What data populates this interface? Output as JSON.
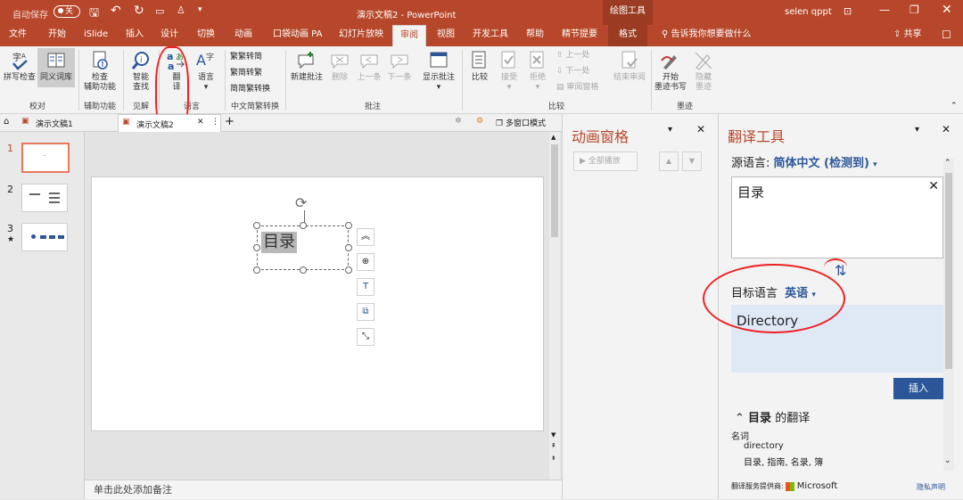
{
  "titlebar": {
    "autosave": "自动保存",
    "autosave_state": "关",
    "doc_title": "演示文稿2  -  PowerPoint",
    "context_tool": "绘图工具",
    "user": "selen qppt"
  },
  "tabs": [
    "文件",
    "开始",
    "iSlide",
    "插入",
    "设计",
    "切换",
    "动画",
    "口袋动画 PA",
    "幻灯片放映",
    "审阅",
    "视图",
    "开发工具",
    "帮助",
    "精节提要",
    "格式"
  ],
  "active_tab": "审阅",
  "tellme": "告诉我你想要做什么",
  "share": "共享",
  "ribbon": {
    "spell": "拼写检查",
    "thesaurus": "同义词库",
    "proof_group": "校对",
    "check_access_1": "检查",
    "check_access_2": "辅助功能",
    "access_group": "辅助功能",
    "smart_1": "智能",
    "smart_2": "查找",
    "insight_group": "见解",
    "translate_1": "翻",
    "translate_2": "译",
    "lang": "语言",
    "lang_group": "语言",
    "t2s": "繁转简",
    "s2t": "简转繁",
    "convert": "简繁转换",
    "cn_group": "中文简繁转换",
    "new_comment": "新建批注",
    "delete": "删除",
    "prev": "上一条",
    "next": "下一条",
    "show_comments": "显示批注",
    "comment_group": "批注",
    "compare": "比较",
    "accept": "接受",
    "reject": "拒绝",
    "prev2": "上一处",
    "next2": "下一处",
    "review_pane": "审阅窗格",
    "end_review": "结束审阅",
    "compare_group": "比较",
    "ink_start_1": "开始",
    "ink_start_2": "墨迹书写",
    "hide_ink_1": "隐藏",
    "hide_ink_2": "墨迹",
    "ink_group": "墨迹"
  },
  "doctabs": {
    "tab1": "演示文稿1",
    "tab2": "演示文稿2",
    "multiwin": "多窗口模式"
  },
  "slides": [
    "1",
    "2",
    "3"
  ],
  "slide_text": "目录",
  "notes_placeholder": "单击此处添加备注",
  "anim_pane": {
    "title": "动画窗格",
    "play_all": "全部播放"
  },
  "translate_pane": {
    "title": "翻译工具",
    "source_label": "源语言:",
    "source_value": "简体中文 (检测到)",
    "source_text": "目录",
    "target_label": "目标语言",
    "target_value": "英语",
    "target_text": "Directory",
    "insert": "插入",
    "word": "目录",
    "of_translation": "的翻译",
    "pos": "名词",
    "main_trans": "directory",
    "alt_trans": "目录, 指南, 名录, 簿",
    "provider": "翻译服务提供商:",
    "provider_name": "Microsoft",
    "privacy": "隐私声明"
  },
  "colors": {
    "brand": "#b7472a",
    "accent_blue": "#2b579a",
    "annotation": "#e22222"
  }
}
